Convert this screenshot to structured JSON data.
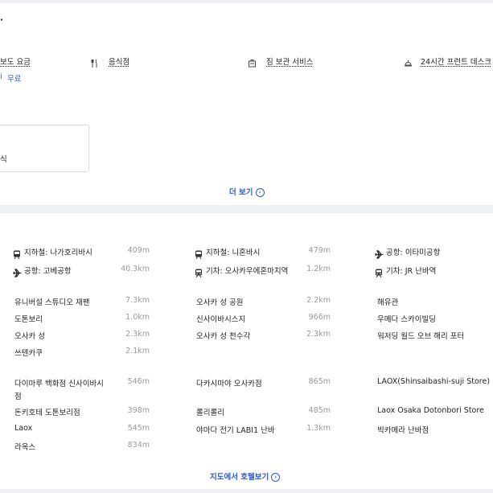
{
  "top_card": {
    "truncated_title": "·",
    "facilities": [
      {
        "icon": "truncated-text",
        "label": "보도 요금"
      },
      {
        "icon": "utensils-icon",
        "label": "음식점"
      },
      {
        "icon": "luggage-icon",
        "label": "짐 보관 서비스"
      },
      {
        "icon": "reception-bell-icon",
        "label": "24시간 프런트 데스크"
      }
    ],
    "wifi_partial": "i",
    "wifi_value": "무료",
    "box_text": "식",
    "more_label": "더 보기",
    "more_icon": "›"
  },
  "transport": [
    {
      "icon": "subway-icon",
      "label": "지하철: 나가호리바시",
      "distance": "409m"
    },
    {
      "icon": "subway-icon",
      "label": "지하철: 니혼바시",
      "distance": "479m"
    },
    {
      "icon": "plane-icon",
      "label": "공항: 이타미공항",
      "distance": ""
    },
    {
      "icon": "plane-icon",
      "label": "공항: 고베공항",
      "distance": "40.3km"
    },
    {
      "icon": "train-icon",
      "label": "기차: 오사카우에혼마치역",
      "distance": "1.2km"
    },
    {
      "icon": "train-icon",
      "label": "기차: JR 난바역",
      "distance": ""
    }
  ],
  "landmarks": [
    {
      "label": "유니버설 스튜디오 재팬",
      "distance": "7.3km"
    },
    {
      "label": "오사카 성 공원",
      "distance": "2.2km"
    },
    {
      "label": "해유관",
      "distance": ""
    },
    {
      "label": "도톤보리",
      "distance": "1.0km"
    },
    {
      "label": "신사이바시스지",
      "distance": "966m"
    },
    {
      "label": "우메다 스카이빌딩",
      "distance": ""
    },
    {
      "label": "오사카 성",
      "distance": "2.3km"
    },
    {
      "label": "오사카 성 천수각",
      "distance": "2.3km"
    },
    {
      "label": "워저딩 월드 오브 해리 포터",
      "distance": ""
    },
    {
      "label": "쓰텐카쿠",
      "distance": "2.1km"
    }
  ],
  "shopping": [
    {
      "label": "다이마루 백화점 신사이바시",
      "label2": "점",
      "distance": "546m"
    },
    {
      "label": "다카시마야 오사카점",
      "label2": "",
      "distance": "865m"
    },
    {
      "label": "LAOX(Shinsaibashi-suji Store)",
      "label2": "",
      "distance": ""
    },
    {
      "label": "돈키호테 도톤보리점",
      "label2": "",
      "distance": "398m"
    },
    {
      "label": "롤리롤리",
      "label2": "",
      "distance": "485m"
    },
    {
      "label": "Laox Osaka Dotonbori Store",
      "label2": "",
      "distance": ""
    },
    {
      "label": "Laox",
      "label2": "",
      "distance": "545m"
    },
    {
      "label": "야마다 전기 LABI1 난바",
      "label2": "",
      "distance": "1.3km"
    },
    {
      "label": "빅카메라 난바점",
      "label2": "",
      "distance": ""
    },
    {
      "label": "라옥스",
      "label2": "",
      "distance": "834m"
    }
  ],
  "map_link_label": "지도에서 호텔보기",
  "colors": {
    "accent": "#2c59d6",
    "background": "#eef0f3"
  }
}
